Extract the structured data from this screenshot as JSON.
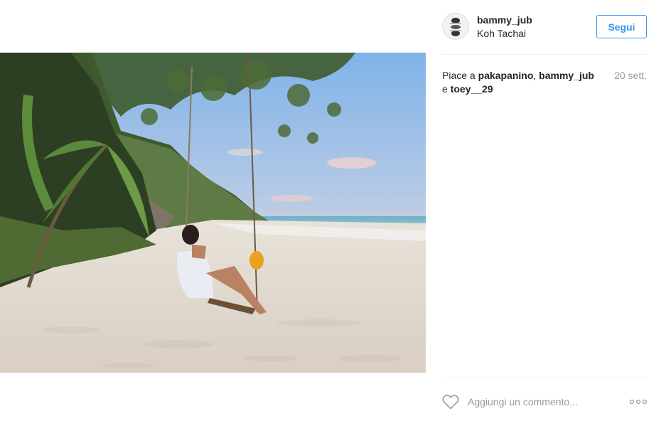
{
  "post": {
    "username": "bammy_jub",
    "location": "Koh Tachai",
    "follow_label": "Segui",
    "likes": {
      "prefix": "Piace a",
      "users": [
        "pakapanino",
        "bammy_jub",
        "toey__29"
      ],
      "separator": ", ",
      "conjunction": "e"
    },
    "date": "20 sett.",
    "comment_placeholder": "Aggiungi un commento...",
    "icons": {
      "like": "heart-icon",
      "more": "more-options-icon",
      "avatar": "avatar"
    }
  },
  "colors": {
    "accent": "#3897f0",
    "muted": "#999999",
    "text": "#262626",
    "divider": "#efefef"
  }
}
